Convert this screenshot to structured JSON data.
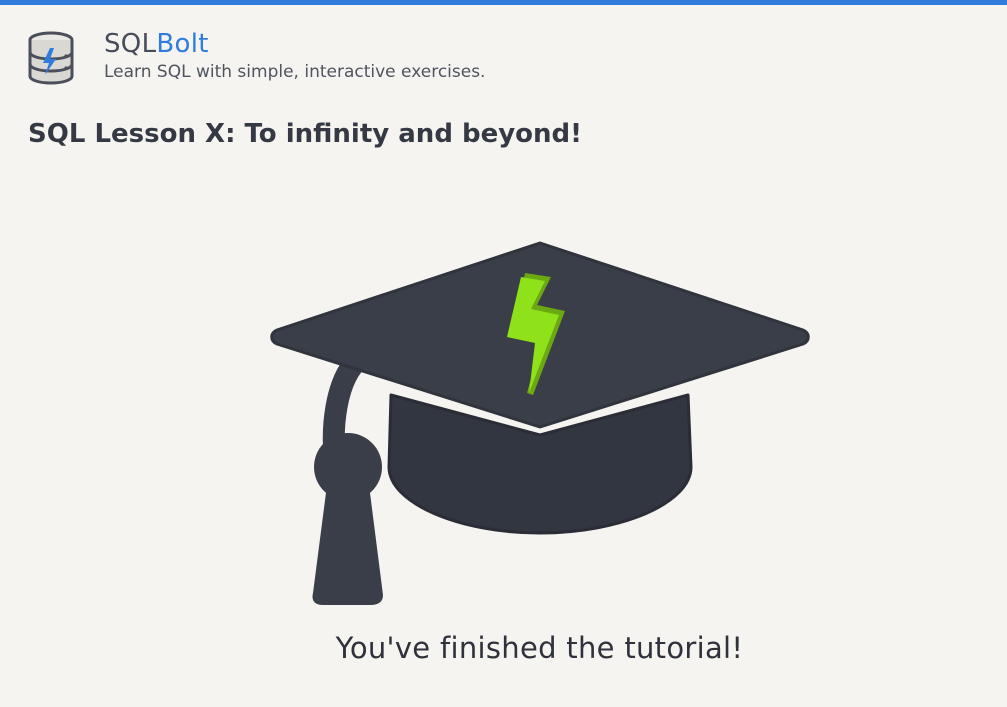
{
  "brand": {
    "name_prefix": "SQL",
    "name_suffix": "Bolt",
    "tagline": "Learn SQL with simple, interactive exercises."
  },
  "lesson": {
    "title": "SQL Lesson X: To infinity and beyond!"
  },
  "illustration": {
    "icon": "graduation-cap-icon",
    "bolt_color": "#8fe21a"
  },
  "message": "You've finished the tutorial!",
  "colors": {
    "accent": "#2f7cdc",
    "background": "#f5f4f1",
    "dark": "#3a3e48"
  }
}
